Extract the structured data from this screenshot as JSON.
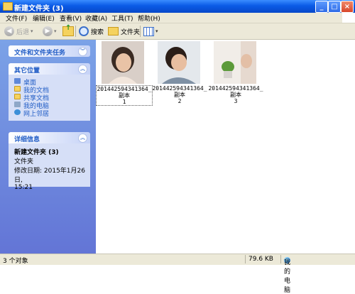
{
  "window": {
    "title": "新建文件夹 (3)"
  },
  "menu": [
    "文件(F)",
    "编辑(E)",
    "查看(V)",
    "收藏(A)",
    "工具(T)",
    "帮助(H)"
  ],
  "toolbar": {
    "back": "后退",
    "search": "搜索",
    "folders": "文件夹"
  },
  "sidebar": {
    "tasks_title": "文件和文件夹任务",
    "places_title": "其它位置",
    "places": [
      "桌面",
      "我的文档",
      "共享文档",
      "我的电脑",
      "网上邻居"
    ],
    "details_title": "详细信息",
    "details": {
      "name": "新建文件夹 (3)",
      "type": "文件夹",
      "modified_label": "修改日期: 2015年1月26日,",
      "modified_time": "15:21"
    }
  },
  "files": [
    {
      "name_line1": "201442594341364_副本",
      "name_line2": "1"
    },
    {
      "name_line1": "201442594341364_副本",
      "name_line2": "2"
    },
    {
      "name_line1": "201442594341364_副本",
      "name_line2": "3"
    }
  ],
  "status": {
    "count": "3 个对象",
    "size": "79.6 KB",
    "location": "我的电脑"
  },
  "colors": {
    "title_bar": "#0A5BE6",
    "sidebar_top": "#7BA2E7",
    "sidebar_bottom": "#6375D6",
    "panel_text": "#215DC6"
  }
}
